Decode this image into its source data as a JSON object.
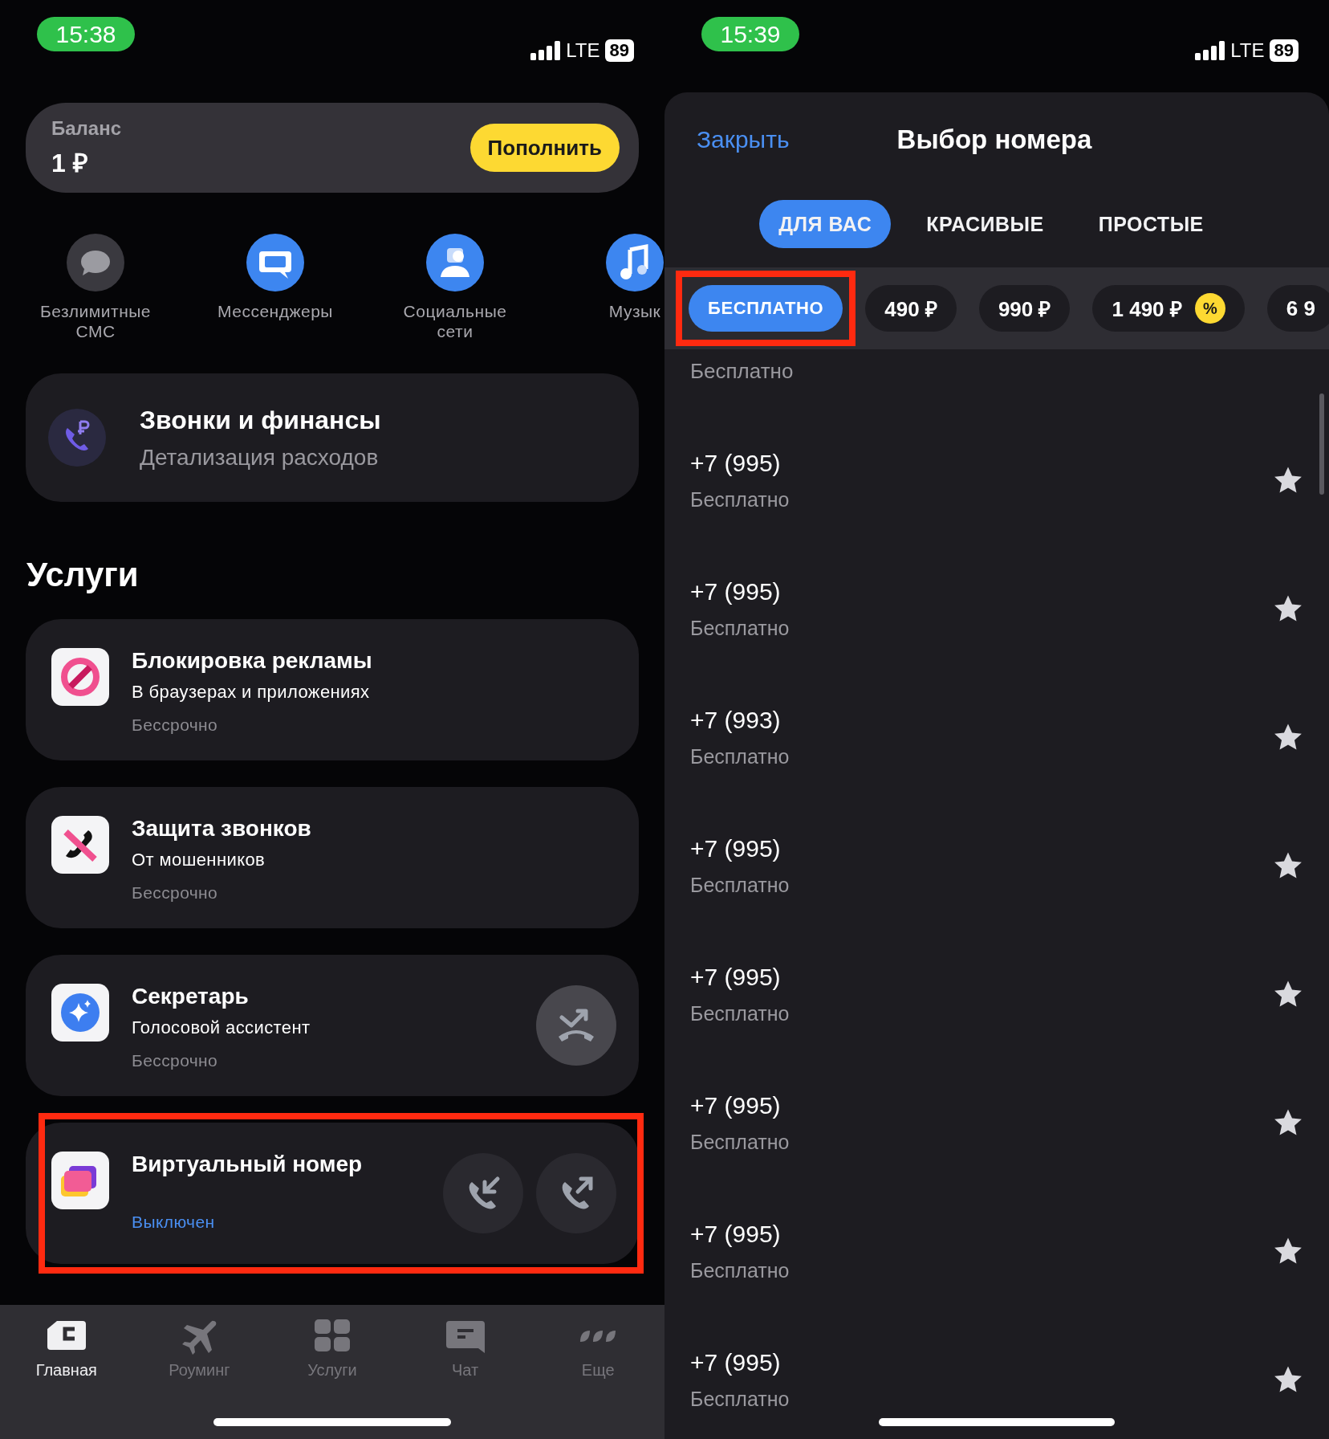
{
  "left_screen": {
    "status_bar": {
      "time": "15:38",
      "network": "LTE",
      "battery": "89"
    },
    "balance": {
      "label": "Баланс",
      "amount": "1 ₽",
      "button": "Пополнить"
    },
    "shortcuts": [
      {
        "kind": "sms",
        "label": "Безлимитные СМС"
      },
      {
        "kind": "messengers",
        "label": "Мессенджеры"
      },
      {
        "kind": "social",
        "label": "Социальные сети"
      },
      {
        "kind": "music",
        "label": "Музык"
      }
    ],
    "calls_card": {
      "title": "Звонки и финансы",
      "subtitle": "Детализация расходов"
    },
    "services_heading": "Услуги",
    "services": [
      {
        "kind": "adblock",
        "title": "Блокировка рекламы",
        "subtitle": "В браузерах и приложениях",
        "term": "Бессрочно",
        "highlighted": false
      },
      {
        "kind": "call_protect",
        "title": "Защита звонков",
        "subtitle": "От мошенников",
        "term": "Бессрочно",
        "highlighted": false
      },
      {
        "kind": "secretary",
        "title": "Секретарь",
        "subtitle": "Голосовой ассистент",
        "term": "Бессрочно",
        "highlighted": false
      },
      {
        "kind": "virtual_number",
        "title": "Виртуальный номер",
        "status": "Выключен",
        "highlighted": true
      }
    ],
    "bottom_nav": [
      {
        "kind": "home",
        "label": "Главная",
        "selected": true
      },
      {
        "kind": "roaming",
        "label": "Роуминг",
        "selected": false
      },
      {
        "kind": "services",
        "label": "Услуги",
        "selected": false
      },
      {
        "kind": "chat",
        "label": "Чат",
        "selected": false
      },
      {
        "kind": "more",
        "label": "Еще",
        "selected": false
      }
    ]
  },
  "right_screen": {
    "status_bar": {
      "time": "15:39",
      "network": "LTE",
      "battery": "89"
    },
    "close": "Закрыть",
    "title": "Выбор номера",
    "tabs": [
      {
        "label": "ДЛЯ ВАС",
        "selected": true
      },
      {
        "label": "КРАСИВЫЕ",
        "selected": false
      },
      {
        "label": "ПРОСТЫЕ",
        "selected": false
      }
    ],
    "price_filters": [
      {
        "label": "БЕСПЛАТНО",
        "selected": true,
        "discount": false,
        "highlighted": true
      },
      {
        "label": "490 ₽",
        "selected": false,
        "discount": false,
        "highlighted": false
      },
      {
        "label": "990 ₽",
        "selected": false,
        "discount": false,
        "highlighted": false
      },
      {
        "label": "1 490 ₽",
        "selected": false,
        "discount": true,
        "highlighted": false
      },
      {
        "label": "6 9",
        "selected": false,
        "discount": false,
        "highlighted": false
      }
    ],
    "discount_badge": "%",
    "section_label": "Бесплатно",
    "numbers": [
      {
        "number": "+7 (995)",
        "price": "Бесплатно"
      },
      {
        "number": "+7 (995)",
        "price": "Бесплатно"
      },
      {
        "number": "+7 (993)",
        "price": "Бесплатно"
      },
      {
        "number": "+7 (995)",
        "price": "Бесплатно"
      },
      {
        "number": "+7 (995)",
        "price": "Бесплатно"
      },
      {
        "number": "+7 (995)",
        "price": "Бесплатно"
      },
      {
        "number": "+7 (995)",
        "price": "Бесплатно"
      },
      {
        "number": "+7 (995)",
        "price": "Бесплатно"
      }
    ]
  }
}
